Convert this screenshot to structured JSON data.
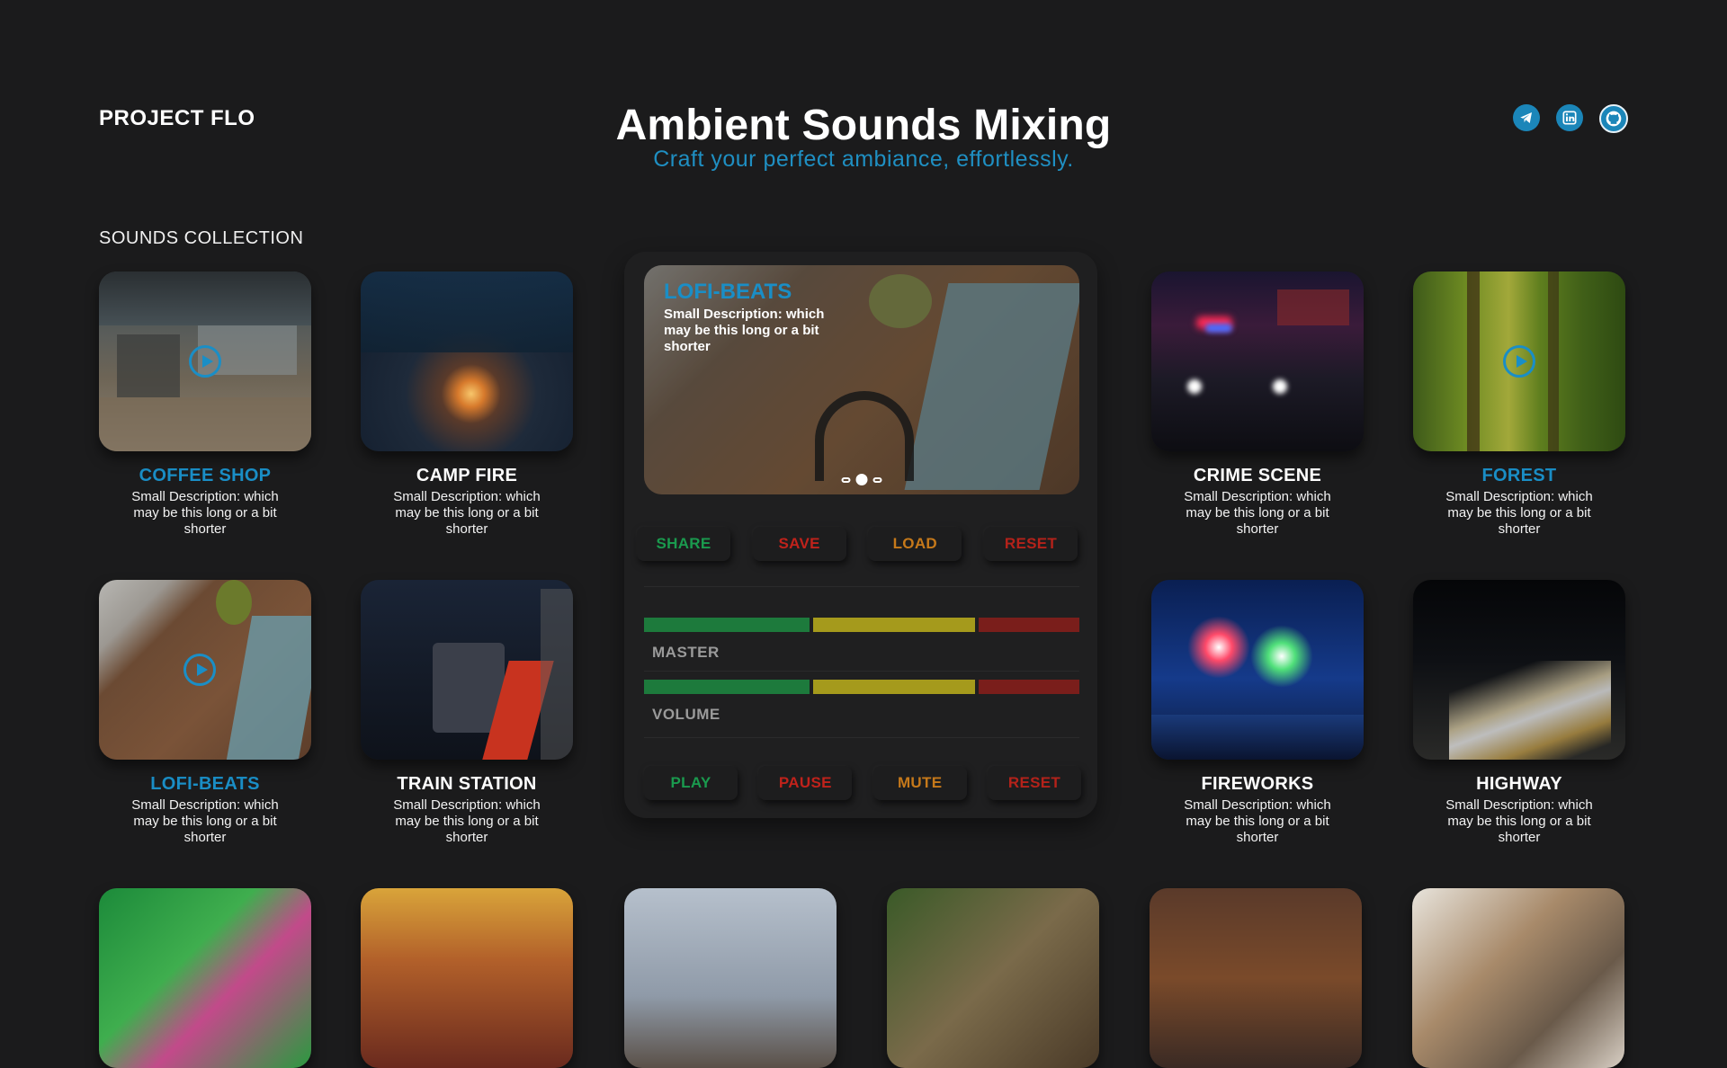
{
  "header": {
    "brand": "PROJECT FLO",
    "title": "Ambient Sounds Mixing",
    "subtitle": "Craft your perfect ambiance, effortlessly.",
    "socials": [
      {
        "icon": "telegram-icon"
      },
      {
        "icon": "linkedin-icon"
      },
      {
        "icon": "github-icon"
      }
    ]
  },
  "section": {
    "label": "SOUNDS COLLECTION"
  },
  "sounds": [
    {
      "name": "COFFEE SHOP",
      "desc": "Small Description: which may be this long or a bit shorter",
      "highlighted": true
    },
    {
      "name": "CAMP FIRE",
      "desc": "Small Description: which may be this long or a bit shorter",
      "highlighted": false
    },
    {
      "name": "CRIME SCENE",
      "desc": "Small Description: which may be this long or a bit shorter",
      "highlighted": false
    },
    {
      "name": "FOREST",
      "desc": "Small Description: which may be this long or a bit shorter",
      "highlighted": true
    },
    {
      "name": "LOFI-BEATS",
      "desc": "Small Description: which may be this long or a bit shorter",
      "highlighted": true
    },
    {
      "name": "TRAIN STATION",
      "desc": "Small Description: which may be this long or a bit shorter",
      "highlighted": false
    },
    {
      "name": "FIREWORKS",
      "desc": "Small Description: which may be this long or a bit shorter",
      "highlighted": false
    },
    {
      "name": "HIGHWAY",
      "desc": "Small Description: which may be this long or a bit shorter",
      "highlighted": false
    }
  ],
  "player": {
    "now_playing_title": "LOFI-BEATS",
    "now_playing_desc": "Small Description: which may be this long or a bit shorter",
    "carousel": {
      "count": 3,
      "active": 2
    },
    "actions": {
      "share": "SHARE",
      "save": "SAVE",
      "load": "LOAD",
      "reset": "RESET"
    },
    "master_label": "MASTER",
    "volume_label": "VOLUME",
    "controls": {
      "play": "PLAY",
      "pause": "PAUSE",
      "mute": "MUTE",
      "reset": "RESET"
    },
    "colors": {
      "green": "#1a9a4e",
      "red": "#c0221b",
      "orange": "#c6791a",
      "meter_green": "#1d7a3c",
      "meter_yellow": "#a59a1c",
      "meter_red": "#7a1e1b"
    }
  }
}
